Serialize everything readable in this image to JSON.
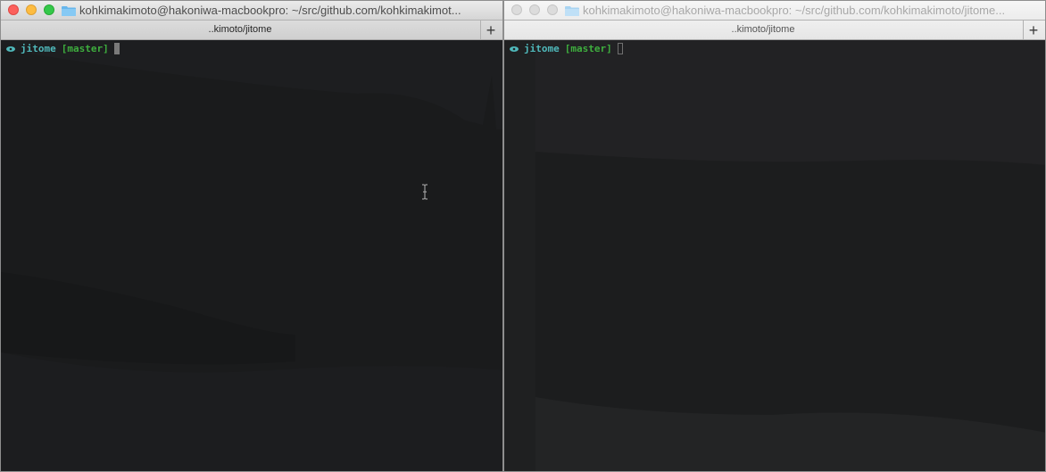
{
  "windows": [
    {
      "id": "left",
      "title": "kohkimakimoto@hakoniwa-macbookpro: ~/src/github.com/kohkimakimot...",
      "tab": "..kimoto/jitome",
      "active": true,
      "prompt": {
        "dir": "jitome",
        "branch": "[master]"
      }
    },
    {
      "id": "right",
      "title": "kohkimakimoto@hakoniwa-macbookpro: ~/src/github.com/kohkimakimoto/jitome...",
      "tab": "..kimoto/jitome",
      "active": false,
      "prompt": {
        "dir": "jitome",
        "branch": "[master]"
      }
    }
  ],
  "tab_add_label": "+",
  "icons": [
    "folder-icon",
    "eye-icon",
    "ibeam-cursor-icon",
    "plus-icon"
  ],
  "colors": {
    "close": "#fc605c",
    "minimize": "#fdbc40",
    "zoom": "#34c84a",
    "prompt_dir": "#4fb8ba",
    "prompt_branch": "#3eae3e"
  }
}
